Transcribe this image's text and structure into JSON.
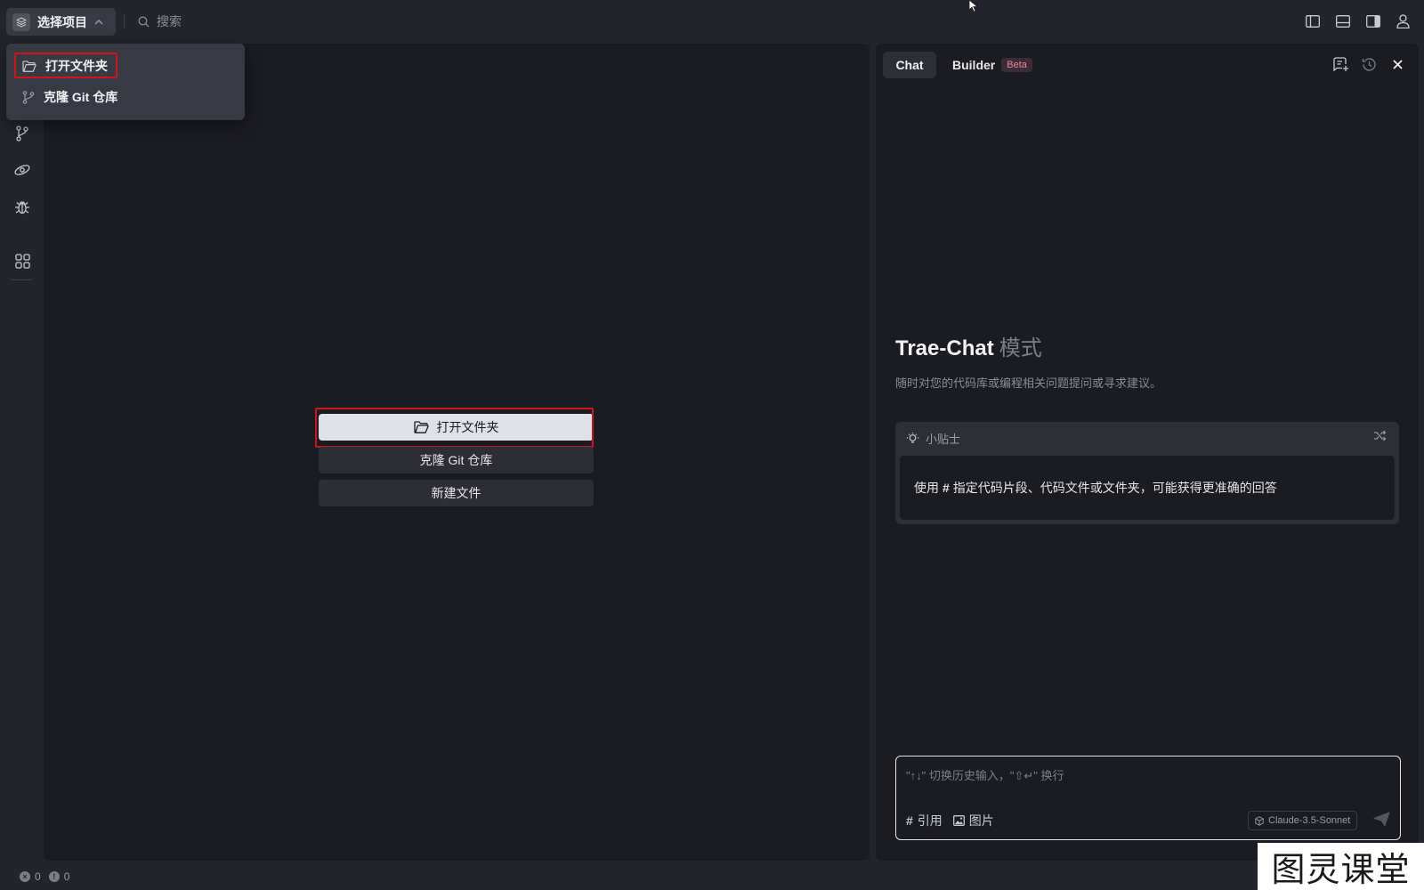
{
  "titlebar": {
    "project_label": "选择项目",
    "search_placeholder": "搜索"
  },
  "dropdown": {
    "items": [
      {
        "label": "打开文件夹",
        "icon": "folder-icon"
      },
      {
        "label": "克隆 Git 仓库",
        "icon": "git-branch-icon"
      }
    ]
  },
  "editor": {
    "buttons": {
      "open_folder": "打开文件夹",
      "clone_git": "克隆 Git 仓库",
      "new_file": "新建文件"
    }
  },
  "chat": {
    "tabs": {
      "chat": "Chat",
      "builder": "Builder",
      "beta": "Beta"
    },
    "mode_title": "Trae-Chat",
    "mode_suffix": "模式",
    "mode_desc": "随时对您的代码库或编程相关问题提问或寻求建议。",
    "tips": {
      "title": "小贴士",
      "body_prefix": "使用",
      "body_hash": "#",
      "body_suffix": "指定代码片段、代码文件或文件夹，可能获得更准确的回答"
    },
    "input": {
      "placeholder": "\"↑↓\" 切换历史输入，\"⇧↵\" 换行",
      "ref_label": "引用",
      "image_label": "图片",
      "model": "Claude-3.5-Sonnet"
    }
  },
  "statusbar": {
    "errors": "0",
    "warnings": "0"
  },
  "watermark": "图灵课堂",
  "colors": {
    "highlight": "#d0141b",
    "panel_bg": "#1b1c22",
    "chrome_bg": "#24252c",
    "beta_badge": "#f0829b"
  }
}
